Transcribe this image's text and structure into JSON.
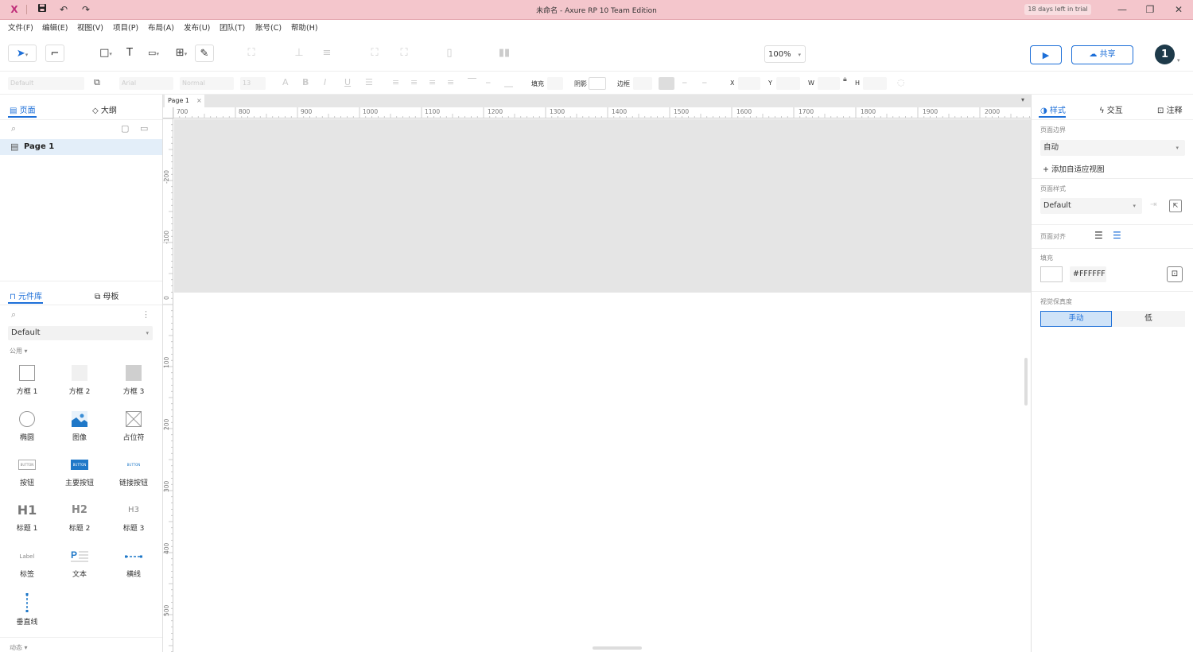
{
  "window": {
    "title": "未命名 - Axure RP 10 Team Edition",
    "trial": "18 days left in trial"
  },
  "menu": [
    "文件(F)",
    "编辑(E)",
    "视图(V)",
    "项目(P)",
    "布局(A)",
    "发布(U)",
    "团队(T)",
    "账号(C)",
    "帮助(H)"
  ],
  "toolbar": {
    "zoom": "100%",
    "share": "共享",
    "avatar": "1"
  },
  "style_toolbar": {
    "style_select": "Default",
    "font_select": "Arial",
    "weight_select": "Normal",
    "size_select": "13",
    "fill_label": "填充",
    "shadow_label": "阴影",
    "border_label": "边框",
    "x_label": "X",
    "y_label": "Y",
    "w_label": "W",
    "h_label": "H"
  },
  "left_panel": {
    "tabs": {
      "pages": "页面",
      "outline": "大纲"
    },
    "pages": [
      {
        "label": "Page 1"
      }
    ],
    "lib_tabs": {
      "library": "元件库",
      "masters": "母板"
    },
    "library_select": "Default",
    "group": "公用",
    "widgets": [
      {
        "label": "方框 1"
      },
      {
        "label": "方框 2"
      },
      {
        "label": "方框 3"
      },
      {
        "label": "椭圆"
      },
      {
        "label": "图像"
      },
      {
        "label": "占位符"
      },
      {
        "label": "按钮"
      },
      {
        "label": "主要按钮"
      },
      {
        "label": "链接按钮"
      },
      {
        "label": "标题 1"
      },
      {
        "label": "标题 2"
      },
      {
        "label": "标题 3"
      },
      {
        "label": "标签"
      },
      {
        "label": "文本"
      },
      {
        "label": "横线"
      },
      {
        "label": "垂直线"
      }
    ],
    "widget_previews": {
      "button_text": "BUTTON",
      "h1": "H1",
      "h2": "H2",
      "h3": "H3",
      "label_text": "Label"
    },
    "footer_group": "动态"
  },
  "canvas": {
    "tab": "Page 1",
    "ruler_h": [
      "700",
      "800",
      "900",
      "1000",
      "1100",
      "1200",
      "1300",
      "1400",
      "1500",
      "1600",
      "1700",
      "1800",
      "1900",
      "2000"
    ],
    "ruler_v": [
      "-200",
      "-100",
      "0",
      "100",
      "200",
      "300",
      "400",
      "500"
    ]
  },
  "right_panel": {
    "tabs": {
      "style": "样式",
      "interactions": "交互",
      "notes": "注释"
    },
    "page_dimensions_label": "页面边界",
    "page_dimensions_value": "自动",
    "add_adaptive": "+ 添加自适应视图",
    "page_style_label": "页面样式",
    "page_style_value": "Default",
    "page_align_label": "页面对齐",
    "fill_label": "填充",
    "fill_value": "#FFFFFF",
    "quality_label": "视觉保真度",
    "quality_options": [
      "手动",
      "低"
    ]
  },
  "colors": {
    "accent": "#1d6fd8",
    "titlebar": "#f4c6cc",
    "canvas_grey": "#e5e5e5"
  }
}
